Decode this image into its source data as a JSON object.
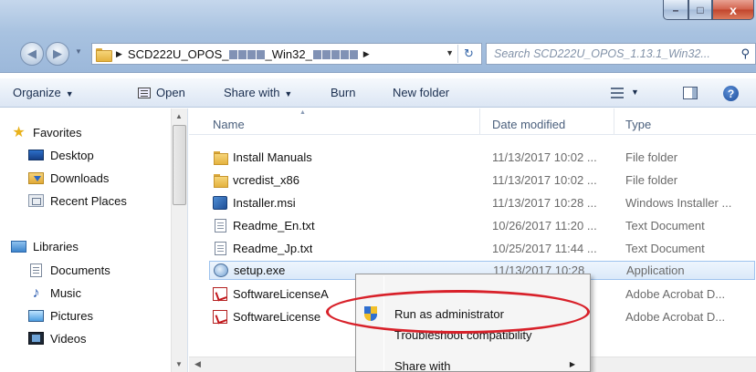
{
  "window": {
    "minimize_label": "–",
    "maximize_label": "□",
    "close_label": "x"
  },
  "address": {
    "crumb": "SCD222U_OPOS_",
    "crumb_middle": "_Win32_",
    "refresh_glyph": "↻",
    "search_placeholder": "Search SCD222U_OPOS_1.13.1_Win32...",
    "search_glyph": "⚲"
  },
  "toolbar": {
    "organize": "Organize",
    "open": "Open",
    "share_with": "Share with",
    "burn": "Burn",
    "new_folder": "New folder",
    "help": "?"
  },
  "navpane": {
    "favorites": "Favorites",
    "desktop": "Desktop",
    "downloads": "Downloads",
    "recent_places": "Recent Places",
    "libraries": "Libraries",
    "documents": "Documents",
    "music": "Music",
    "pictures": "Pictures",
    "videos": "Videos"
  },
  "columns": {
    "name": "Name",
    "date_modified": "Date modified",
    "type": "Type"
  },
  "files": [
    {
      "name": "Install Manuals",
      "date": "11/13/2017 10:02 ...",
      "type": "File folder",
      "icon": "folder-icon"
    },
    {
      "name": "vcredist_x86",
      "date": "11/13/2017 10:02 ...",
      "type": "File folder",
      "icon": "folder-icon"
    },
    {
      "name": "Installer.msi",
      "date": "11/13/2017 10:28 ...",
      "type": "Windows Installer ...",
      "icon": "msi-icon"
    },
    {
      "name": "Readme_En.txt",
      "date": "10/26/2017 11:20 ...",
      "type": "Text Document",
      "icon": "text-file-icon"
    },
    {
      "name": "Readme_Jp.txt",
      "date": "10/25/2017 11:44 ...",
      "type": "Text Document",
      "icon": "text-file-icon"
    },
    {
      "name": "setup.exe",
      "date": "11/13/2017 10:28",
      "type": "Application",
      "icon": "exe-icon"
    },
    {
      "name": "SoftwareLicenseA",
      "date": "",
      "type": "Adobe Acrobat D...",
      "icon": "pdf-icon"
    },
    {
      "name": "SoftwareLicense",
      "date": "",
      "type": "Adobe Acrobat D...",
      "icon": "pdf-icon"
    }
  ],
  "context_menu": {
    "run_as_admin": "Run as administrator",
    "troubleshoot": "Troubleshoot compatibility",
    "share_with": "Share with"
  },
  "colors": {
    "highlight_oval": "#d8212a",
    "selection": "#dbe9f9"
  }
}
